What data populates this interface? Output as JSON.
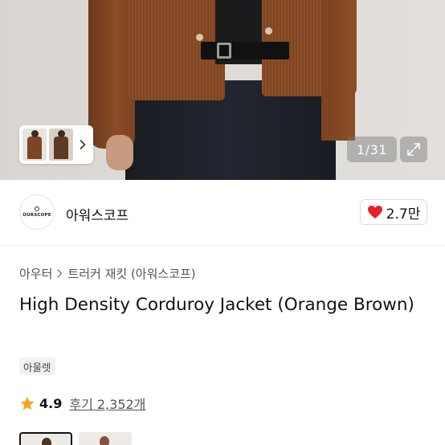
{
  "gallery": {
    "counter": "1/31",
    "thumbnails": [
      "model-front",
      "model-side"
    ]
  },
  "store": {
    "logo_text": "OURSCOPE",
    "name": "아워스코프",
    "like_count": "2.7만"
  },
  "breadcrumb": {
    "items": [
      "아우터",
      "트러커 재킷 (아워스코프)"
    ]
  },
  "product": {
    "title": "High Density Corduroy Jacket (Orange Brown)",
    "tag": "아울렛",
    "rating": "4.9",
    "reviews": "후기 2,352개"
  },
  "colors": {
    "heart": "#e8202a",
    "star": "#f5a623",
    "jacket": "#8a4d27"
  },
  "icons": [
    "chevron-right-icon",
    "expand-icon",
    "heart-icon",
    "star-icon"
  ]
}
